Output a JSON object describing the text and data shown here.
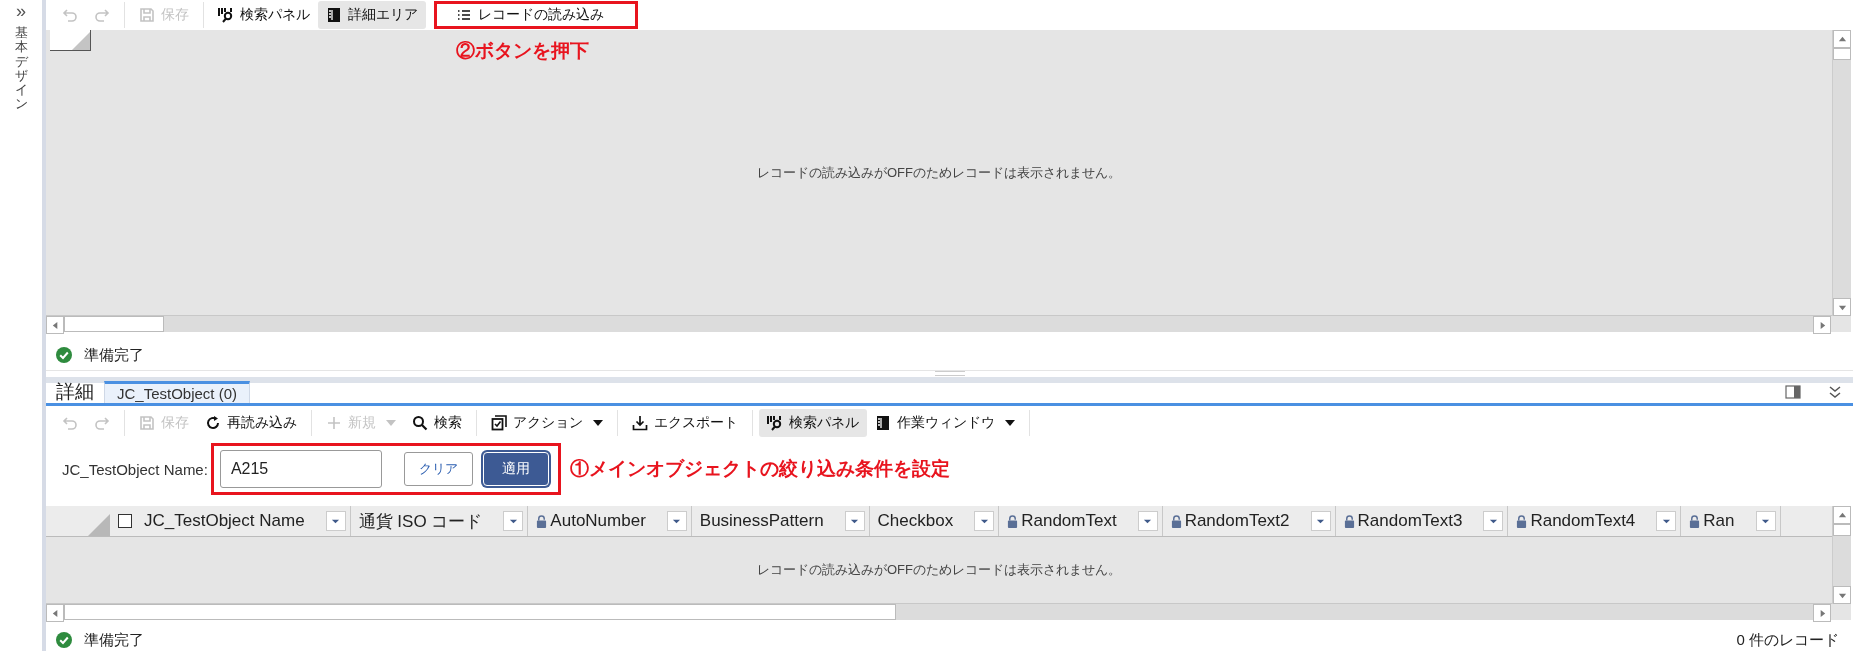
{
  "sidebar": {
    "expand": "»",
    "title": "基本デザイン"
  },
  "top_toolbar": [
    {
      "kind": "undo",
      "disabled": true,
      "active": false,
      "highlighted": false,
      "caret": false
    },
    {
      "kind": "redo",
      "disabled": true,
      "active": false,
      "highlighted": false,
      "caret": false
    },
    {
      "kind": "separator"
    },
    {
      "kind": "save",
      "label": "保存",
      "disabled": true,
      "active": false,
      "highlighted": false,
      "caret": false
    },
    {
      "kind": "separator"
    },
    {
      "kind": "searchpanel",
      "label": "検索パネル",
      "disabled": false,
      "active": false,
      "highlighted": false,
      "caret": false
    },
    {
      "kind": "pane",
      "label": "詳細エリア",
      "disabled": false,
      "active": true,
      "highlighted": false,
      "caret": false
    },
    {
      "kind": "list",
      "label": "レコードの読み込み",
      "disabled": false,
      "active": false,
      "highlighted": true,
      "caret": false
    }
  ],
  "top_grid": {
    "message": "レコードの読み込みがOFFのためレコードは表示されません。",
    "annotation": "②ボタンを押下"
  },
  "top_status": {
    "text": "準備完了"
  },
  "detail": {
    "title": "詳細",
    "tabs": [
      {
        "label": "JC_TestObject (0)",
        "selected": true
      }
    ],
    "toolbar": [
      {
        "kind": "undo",
        "disabled": true,
        "active": false,
        "highlighted": false,
        "caret": false
      },
      {
        "kind": "redo",
        "disabled": true,
        "active": false,
        "highlighted": false,
        "caret": false
      },
      {
        "kind": "separator"
      },
      {
        "kind": "save",
        "label": "保存",
        "disabled": true,
        "active": false,
        "highlighted": false,
        "caret": false
      },
      {
        "kind": "reload",
        "label": "再読み込み",
        "disabled": false,
        "active": false,
        "highlighted": false,
        "caret": false
      },
      {
        "kind": "separator"
      },
      {
        "kind": "plus",
        "label": "新規",
        "disabled": true,
        "active": false,
        "highlighted": false,
        "caret": true
      },
      {
        "kind": "search",
        "label": "検索",
        "disabled": false,
        "active": false,
        "highlighted": false,
        "caret": false
      },
      {
        "kind": "separator"
      },
      {
        "kind": "action",
        "label": "アクション",
        "disabled": false,
        "active": false,
        "highlighted": false,
        "caret": true
      },
      {
        "kind": "separator"
      },
      {
        "kind": "export",
        "label": "エクスポート",
        "disabled": false,
        "active": false,
        "highlighted": false,
        "caret": false
      },
      {
        "kind": "separator"
      },
      {
        "kind": "searchpanel",
        "label": "検索パネル",
        "disabled": false,
        "active": true,
        "highlighted": false,
        "caret": false
      },
      {
        "kind": "pane",
        "label": "作業ウィンドウ",
        "disabled": false,
        "active": false,
        "highlighted": false,
        "caret": true
      },
      {
        "kind": "separator"
      }
    ],
    "filter": {
      "label": "JC_TestObject Name:",
      "value": "A215",
      "clear": "クリア",
      "apply": "適用",
      "highlighted": true,
      "annotation": "①メインオブジェクトの絞り込み条件を設定"
    },
    "grid": {
      "select_all_checked": false,
      "columns": [
        {
          "name": "JC_TestObject Name",
          "locked": false
        },
        {
          "name": "通貨 ISO コード",
          "locked": false
        },
        {
          "name": "AutoNumber",
          "locked": true
        },
        {
          "name": "BusinessPattern",
          "locked": false
        },
        {
          "name": "Checkbox",
          "locked": false
        },
        {
          "name": "RandomText",
          "locked": true
        },
        {
          "name": "RandomText2",
          "locked": true
        },
        {
          "name": "RandomText3",
          "locked": true
        },
        {
          "name": "RandomText4",
          "locked": true
        },
        {
          "name": "Ran",
          "locked": true
        }
      ],
      "message": "レコードの読み込みがOFFのためレコードは表示されません。"
    },
    "status": {
      "text": "準備完了",
      "count": "0 件のレコード"
    }
  }
}
